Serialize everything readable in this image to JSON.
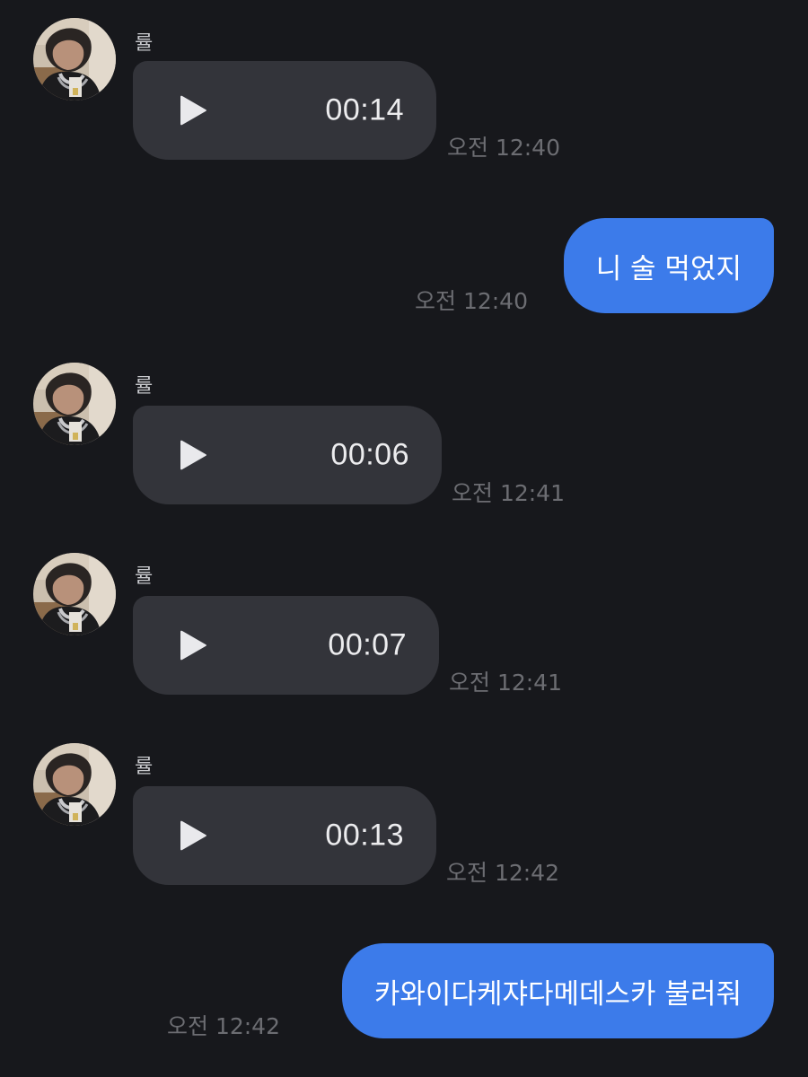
{
  "sender_name": "률",
  "messages": [
    {
      "type": "voice",
      "direction": "in",
      "duration": "00:14",
      "time": "오전 12:40"
    },
    {
      "type": "text",
      "direction": "out",
      "text": "니 술 먹었지",
      "time": "오전 12:40"
    },
    {
      "type": "voice",
      "direction": "in",
      "duration": "00:06",
      "time": "오전 12:41"
    },
    {
      "type": "voice",
      "direction": "in",
      "duration": "00:07",
      "time": "오전 12:41"
    },
    {
      "type": "voice",
      "direction": "in",
      "duration": "00:13",
      "time": "오전 12:42"
    },
    {
      "type": "text",
      "direction": "out",
      "text": "카와이다케쟈다메데스카 불러줘",
      "time": "오전 12:42"
    }
  ],
  "colors": {
    "background": "#17181c",
    "incoming_bubble": "#33343a",
    "outgoing_bubble": "#3c7bea",
    "timestamp": "#6c6d72"
  },
  "icons": {
    "play": "play-icon",
    "avatar": "profile-photo"
  }
}
